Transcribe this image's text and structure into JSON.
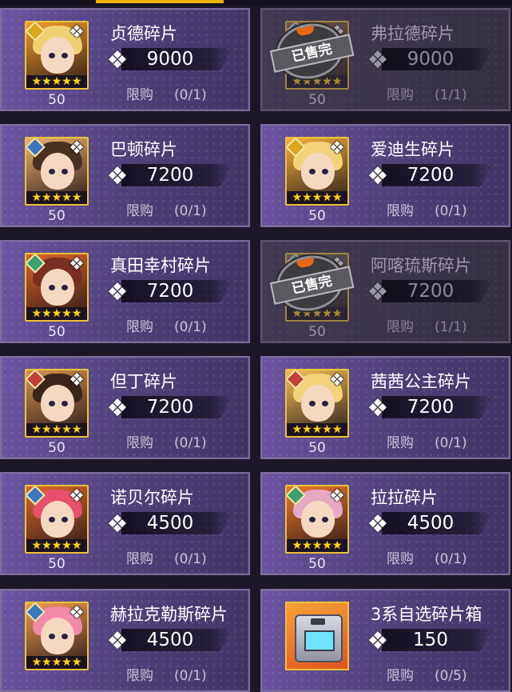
{
  "limit_label": "限购",
  "cards": [
    {
      "name": "贞德碎片",
      "price": "9000",
      "limit": "(0/1)",
      "num": "50",
      "sold": false,
      "element": "light",
      "hair_color": "#f0d070",
      "bg_color": "#f59a2b"
    },
    {
      "name": "弗拉德碎片",
      "price": "9000",
      "limit": "(1/1)",
      "num": "50",
      "sold": true,
      "sold_label": "已售完",
      "element": "dark",
      "hair_color": "#c9a46a",
      "bg_color": "#8a6d4a"
    },
    {
      "name": "巴顿碎片",
      "price": "7200",
      "limit": "(0/1)",
      "num": "50",
      "sold": false,
      "element": "water",
      "hair_color": "#4a3020",
      "bg_color": "#f0b070"
    },
    {
      "name": "爱迪生碎片",
      "price": "7200",
      "limit": "(0/1)",
      "num": "50",
      "sold": false,
      "element": "light",
      "hair_color": "#f3d27a",
      "bg_color": "#f5b13f"
    },
    {
      "name": "真田幸村碎片",
      "price": "7200",
      "limit": "(0/1)",
      "num": "50",
      "sold": false,
      "element": "wind",
      "hair_color": "#7a3020",
      "bg_color": "#e0642a"
    },
    {
      "name": "阿喀琉斯碎片",
      "price": "7200",
      "limit": "(1/1)",
      "num": "50",
      "sold": true,
      "sold_label": "已售完",
      "element": "wind",
      "hair_color": "#6f6a5a",
      "bg_color": "#7a7060"
    },
    {
      "name": "但丁碎片",
      "price": "7200",
      "limit": "(0/1)",
      "num": "50",
      "sold": false,
      "element": "fire",
      "hair_color": "#3b2418",
      "bg_color": "#d89050"
    },
    {
      "name": "茜茜公主碎片",
      "price": "7200",
      "limit": "(0/1)",
      "num": "50",
      "sold": false,
      "element": "fire",
      "hair_color": "#f3d27a",
      "bg_color": "#f6c05a"
    },
    {
      "name": "诺贝尔碎片",
      "price": "4500",
      "limit": "(0/1)",
      "num": "50",
      "sold": false,
      "element": "water",
      "hair_color": "#e8506a",
      "bg_color": "#e0682a"
    },
    {
      "name": "拉拉碎片",
      "price": "4500",
      "limit": "(0/1)",
      "num": "50",
      "sold": false,
      "element": "wind",
      "hair_color": "#e6a8c2",
      "bg_color": "#f07a2a"
    },
    {
      "name": "赫拉克勒斯碎片",
      "price": "4500",
      "limit": "(0/1)",
      "num": "",
      "sold": false,
      "element": "water",
      "hair_color": "#f08aa8",
      "bg_color": "#f59a50"
    },
    {
      "name": "3系自选碎片箱",
      "price": "150",
      "limit": "(0/5)",
      "num": "",
      "sold": false,
      "element": "none",
      "item": "box"
    }
  ],
  "icons": {
    "currency": "puzzle-piece-icon",
    "star": "star-icon"
  }
}
